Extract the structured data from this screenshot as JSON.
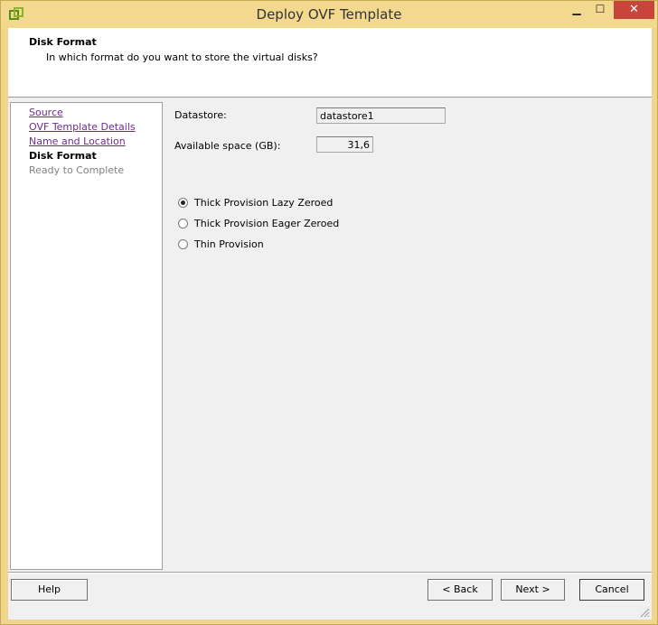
{
  "window": {
    "title": "Deploy OVF Template",
    "controls": {
      "minimize": "▁",
      "maximize": "☐",
      "close": "✕"
    },
    "icon": "ovf-app-icon"
  },
  "header": {
    "title": "Disk Format",
    "subtitle": "In which format do you want to store the virtual disks?"
  },
  "nav": {
    "items": [
      {
        "label": "Source",
        "state": "link"
      },
      {
        "label": "OVF Template Details",
        "state": "link"
      },
      {
        "label": "Name and Location",
        "state": "link"
      },
      {
        "label": "Disk Format",
        "state": "current"
      },
      {
        "label": "Ready to Complete",
        "state": "disabled"
      }
    ]
  },
  "form": {
    "datastore_label": "Datastore:",
    "datastore_value": "datastore1",
    "space_label": "Available space (GB):",
    "space_value": "31,6",
    "options": [
      {
        "label": "Thick Provision Lazy Zeroed",
        "checked": true
      },
      {
        "label": "Thick Provision Eager Zeroed",
        "checked": false
      },
      {
        "label": "Thin Provision",
        "checked": false
      }
    ]
  },
  "buttons": {
    "help": "Help",
    "back": "< Back",
    "next": "Next >",
    "cancel": "Cancel"
  },
  "colors": {
    "titlebar": "#f3d98e",
    "close": "#c9453b",
    "link": "#6d2d8a"
  }
}
